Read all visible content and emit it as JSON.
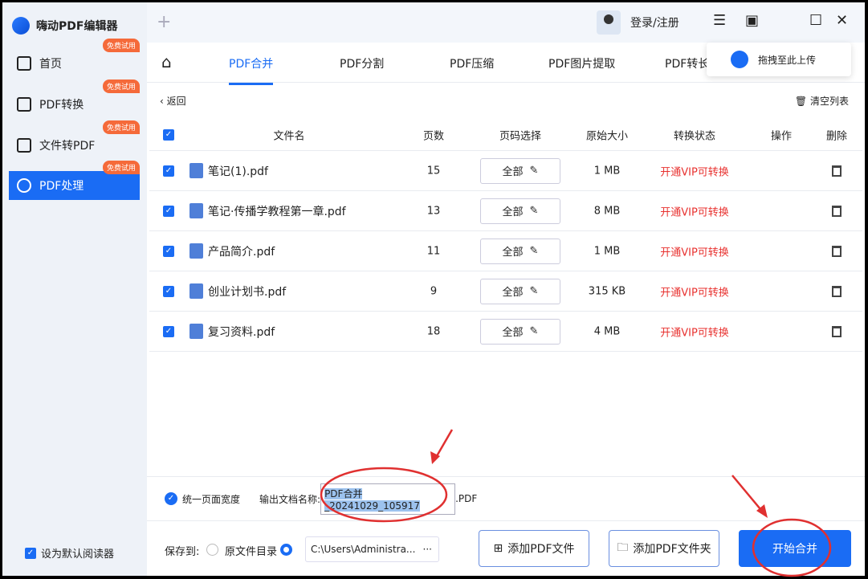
{
  "app": {
    "title": "嗨动PDF编辑器",
    "login": "登录/注册"
  },
  "sidebar": {
    "badge": "免费试用",
    "items": [
      {
        "label": "首页"
      },
      {
        "label": "PDF转换"
      },
      {
        "label": "文件转PDF"
      },
      {
        "label": "PDF处理",
        "active": true
      }
    ],
    "default_reader": "设为默认阅读器"
  },
  "tabs": [
    {
      "label": "PDF合并",
      "active": true
    },
    {
      "label": "PDF分割"
    },
    {
      "label": "PDF压缩"
    },
    {
      "label": "PDF图片提取"
    },
    {
      "label": "PDF转长"
    }
  ],
  "drop_zone": "拖拽至此上传",
  "toolbar": {
    "back": "返回",
    "clear": "清空列表"
  },
  "table": {
    "headers": [
      "文件名",
      "页数",
      "页码选择",
      "原始大小",
      "转换状态",
      "操作",
      "删除"
    ],
    "rows": [
      {
        "name": "笔记(1).pdf",
        "pages": "15",
        "select": "全部",
        "size": "1 MB",
        "status": "开通VIP可转换"
      },
      {
        "name": "笔记·传播学教程第一章.pdf",
        "pages": "13",
        "select": "全部",
        "size": "8 MB",
        "status": "开通VIP可转换"
      },
      {
        "name": "产品简介.pdf",
        "pages": "11",
        "select": "全部",
        "size": "1 MB",
        "status": "开通VIP可转换"
      },
      {
        "name": "创业计划书.pdf",
        "pages": "9",
        "select": "全部",
        "size": "315 KB",
        "status": "开通VIP可转换"
      },
      {
        "name": "复习资料.pdf",
        "pages": "18",
        "select": "全部",
        "size": "4 MB",
        "status": "开通VIP可转换"
      }
    ]
  },
  "options": {
    "uniform_width": "统一页面宽度",
    "output_label": "输出文档名称:",
    "output_name": "PDF合并_20241029_105917",
    "ext": ".PDF"
  },
  "bottom": {
    "save_to": "保存到:",
    "original_dir": "原文件目录",
    "path": "C:\\Users\\Administra...",
    "more": "···",
    "add_file": "添加PDF文件",
    "add_folder": "添加PDF文件夹",
    "start": "开始合并"
  },
  "colors": {
    "accent": "#1a6cf4",
    "vip": "#e8312f",
    "badge": "#f56a3a"
  }
}
